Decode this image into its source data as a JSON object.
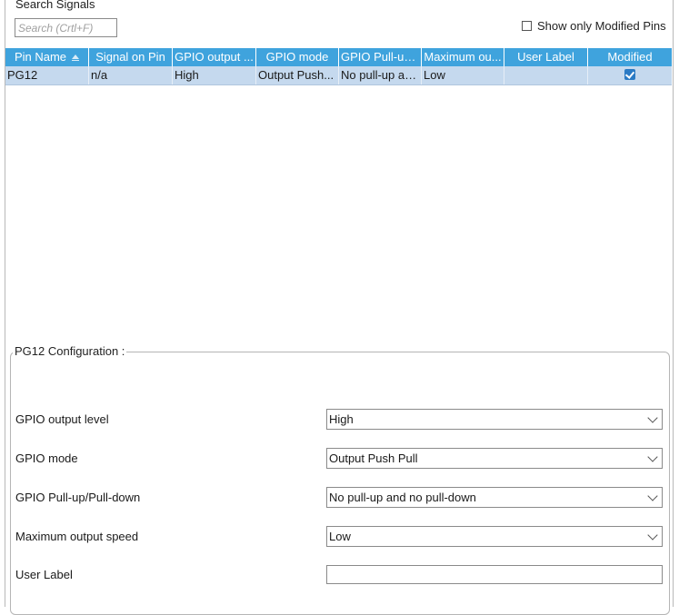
{
  "search": {
    "title": "Search Signals",
    "placeholder": "Search (Crtl+F)",
    "value": ""
  },
  "show_modified": {
    "label": "Show only Modified Pins",
    "checked": false
  },
  "table": {
    "columns": [
      "Pin Name",
      "Signal on Pin",
      "GPIO output ...",
      "GPIO mode",
      "GPIO Pull-up...",
      "Maximum ou...",
      "User Label",
      "Modified"
    ],
    "sort_column": "Pin Name",
    "rows": [
      {
        "pin": "PG12",
        "signal": "n/a",
        "output": "High",
        "mode": "Output Push...",
        "pull": "No pull-up an...",
        "speed": "Low",
        "label": "",
        "modified": true
      }
    ]
  },
  "config": {
    "title": "PG12 Configuration :",
    "fields": [
      {
        "label": "GPIO output level",
        "value": "High"
      },
      {
        "label": "GPIO mode",
        "value": "Output Push Pull"
      },
      {
        "label": "GPIO Pull-up/Pull-down",
        "value": "No pull-up and no pull-down"
      },
      {
        "label": "Maximum output speed",
        "value": "Low"
      }
    ],
    "user_label": {
      "label": "User Label",
      "value": ""
    }
  },
  "colors": {
    "header_bg": "#3fa3dd",
    "selected_row_bg": "#c5d9ee",
    "check_accent": "#2a7ac4"
  }
}
